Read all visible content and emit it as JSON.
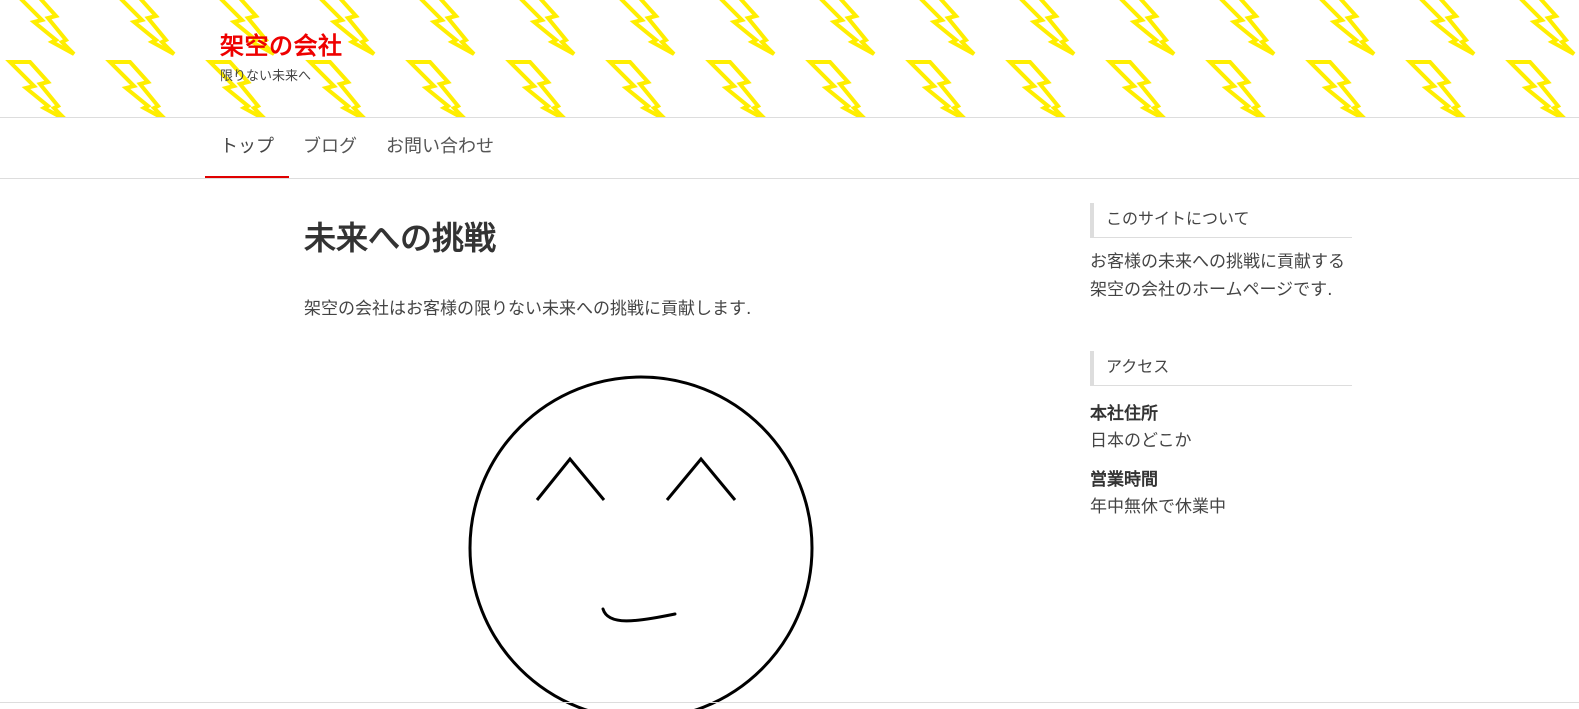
{
  "header": {
    "site_title": "架空の会社",
    "tagline": "限りない未来へ",
    "pattern_color": "#ffee00",
    "title_color": "#ee0000"
  },
  "nav": {
    "items": [
      {
        "label": "トップ",
        "active": true
      },
      {
        "label": "ブログ",
        "active": false
      },
      {
        "label": "お問い合わせ",
        "active": false
      }
    ],
    "accent_color": "#e00000"
  },
  "main": {
    "title": "未来への挑戦",
    "lead": "架空の会社はお客様の限りない未来への挑戦に貢献します.",
    "image_icon": "smiley-face-icon"
  },
  "sidebar": {
    "about": {
      "title": "このサイトについて",
      "text": "お客様の未来への挑戦に貢献する架空の会社のホームページです."
    },
    "access": {
      "title": "アクセス",
      "address_label": "本社住所",
      "address_value": "日本のどこか",
      "hours_label": "営業時間",
      "hours_value": "年中無休で休業中"
    }
  }
}
